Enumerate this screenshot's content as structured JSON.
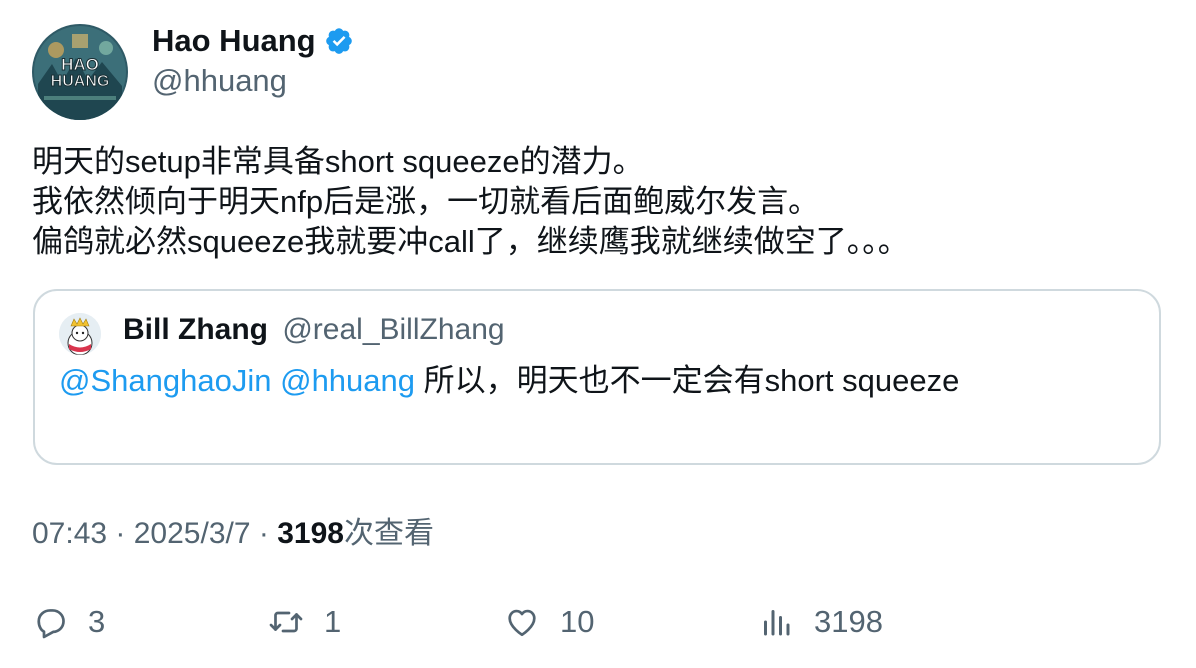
{
  "author": {
    "name": "Hao Huang",
    "handle": "@hhuang",
    "avatar_text_line1": "HAO",
    "avatar_text_line2": "HUANG",
    "verified_color": "#1d9bf0"
  },
  "tweet": {
    "lines": [
      "明天的setup非常具备short squeeze的潜力。",
      "我依然倾向于明天nfp后是涨，一切就看后面鲍威尔发言。",
      "偏鸽就必然squeeze我就要冲call了，继续鹰我就继续做空了。。。"
    ]
  },
  "quote": {
    "name": "Bill Zhang",
    "handle": "@real_BillZhang",
    "mention1": "@ShanghaoJin",
    "mention2": "@hhuang",
    "text": " 所以，明天也不一定会有short squeeze"
  },
  "meta": {
    "time": "07:43",
    "sep1": " · ",
    "date": "2025/3/7",
    "sep2": " · ",
    "views": "3198",
    "views_label": "次查看"
  },
  "actions": {
    "replies": "3",
    "retweets": "1",
    "likes": "10",
    "views": "3198"
  },
  "colors": {
    "text": "#0f1419",
    "secondary": "#536471",
    "accent": "#1d9bf0",
    "border": "#cfd9de"
  }
}
